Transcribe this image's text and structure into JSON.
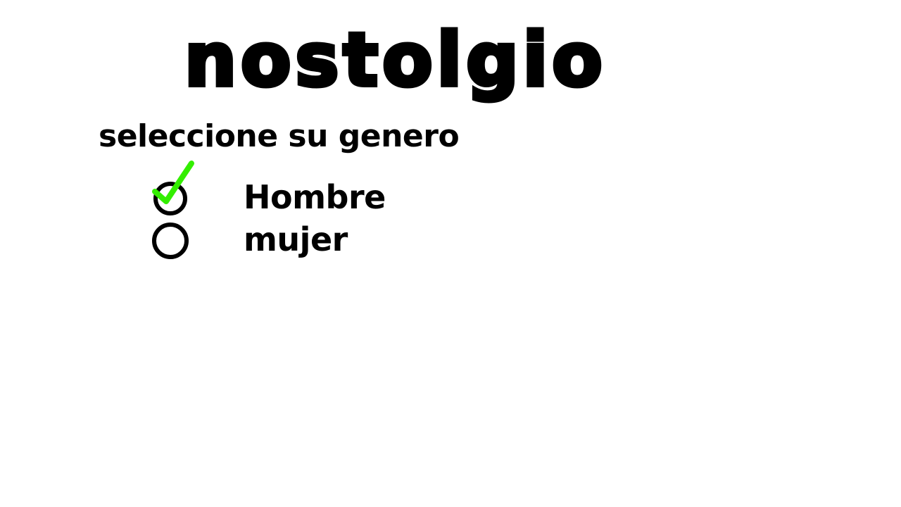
{
  "app": {
    "logo_text": "nostolgio"
  },
  "form": {
    "prompt": "seleccione su genero",
    "options": [
      {
        "label": "Hombre",
        "selected": true
      },
      {
        "label": "mujer",
        "selected": false
      }
    ]
  },
  "colors": {
    "background": "#ffffff",
    "text": "#000000",
    "checkmark": "#33ee00"
  },
  "icons": {
    "selected": "checkmark-icon",
    "radio": "radio-circle-icon"
  }
}
